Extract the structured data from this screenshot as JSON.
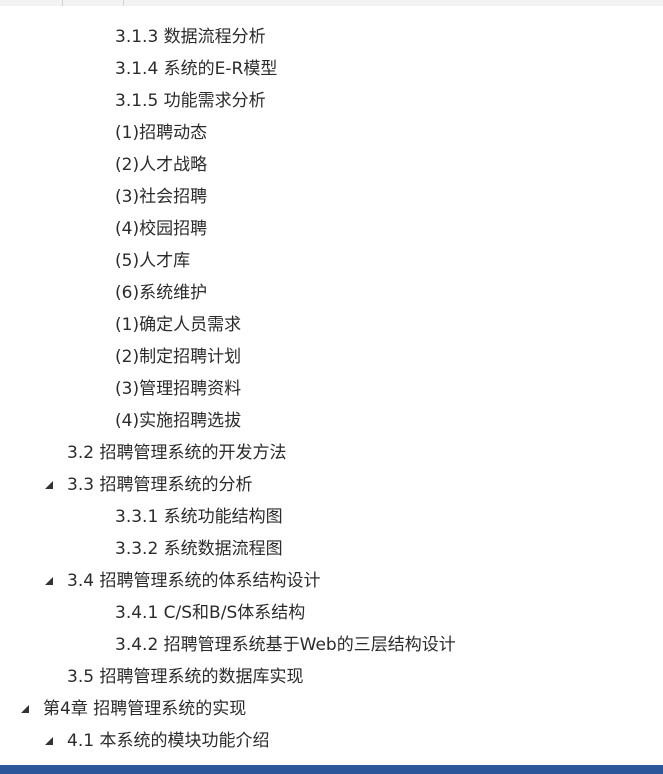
{
  "app": {
    "pane": "navigation",
    "colors": {
      "text": "#2b2b2b",
      "triangle": "#333333",
      "statusbar": "#2b579a",
      "background": "#ffffff"
    }
  },
  "nav": {
    "items": [
      {
        "label": "3.1.3 数据流程分析",
        "level": 3,
        "expander": "none"
      },
      {
        "label": "3.1.4 系统的E-R模型",
        "level": 3,
        "expander": "none"
      },
      {
        "label": "3.1.5 功能需求分析",
        "level": 3,
        "expander": "none"
      },
      {
        "label": "(1)招聘动态",
        "level": 3,
        "expander": "none"
      },
      {
        "label": "(2)人才战略",
        "level": 3,
        "expander": "none"
      },
      {
        "label": "(3)社会招聘",
        "level": 3,
        "expander": "none"
      },
      {
        "label": "(4)校园招聘",
        "level": 3,
        "expander": "none"
      },
      {
        "label": "(5)人才库",
        "level": 3,
        "expander": "none"
      },
      {
        "label": "(6)系统维护",
        "level": 3,
        "expander": "none"
      },
      {
        "label": "(1)确定人员需求",
        "level": 3,
        "expander": "none"
      },
      {
        "label": "(2)制定招聘计划",
        "level": 3,
        "expander": "none"
      },
      {
        "label": "(3)管理招聘资料",
        "level": 3,
        "expander": "none"
      },
      {
        "label": "(4)实施招聘选拔",
        "level": 3,
        "expander": "none"
      },
      {
        "label": "3.2 招聘管理系统的开发方法",
        "level": 2,
        "expander": "none"
      },
      {
        "label": "3.3 招聘管理系统的分析",
        "level": 2,
        "expander": "expanded"
      },
      {
        "label": "3.3.1 系统功能结构图",
        "level": 3,
        "expander": "none"
      },
      {
        "label": "3.3.2 系统数据流程图",
        "level": 3,
        "expander": "none"
      },
      {
        "label": "3.4 招聘管理系统的体系结构设计",
        "level": 2,
        "expander": "expanded"
      },
      {
        "label": "3.4.1 C/S和B/S体系结构",
        "level": 3,
        "expander": "none"
      },
      {
        "label": "3.4.2 招聘管理系统基于Web的三层结构设计",
        "level": 3,
        "expander": "none"
      },
      {
        "label": "3.5 招聘管理系统的数据库实现",
        "level": 2,
        "expander": "none"
      },
      {
        "label": "第4章 招聘管理系统的实现",
        "level": 1,
        "expander": "expanded"
      },
      {
        "label": "4.1 本系统的模块功能介绍",
        "level": 2,
        "expander": "expanded"
      }
    ]
  }
}
